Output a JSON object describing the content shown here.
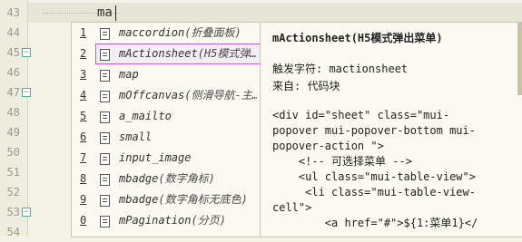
{
  "gutter": {
    "lines": [
      {
        "num": "43",
        "fold": ""
      },
      {
        "num": "44",
        "fold": ""
      },
      {
        "num": "45",
        "fold": "⊟"
      },
      {
        "num": "46",
        "fold": ""
      },
      {
        "num": "47",
        "fold": "⊟"
      },
      {
        "num": "48",
        "fold": ""
      },
      {
        "num": "49",
        "fold": ""
      },
      {
        "num": "50",
        "fold": ""
      },
      {
        "num": "51",
        "fold": ""
      },
      {
        "num": "52",
        "fold": ""
      },
      {
        "num": "53",
        "fold": "⊟"
      },
      {
        "num": "54",
        "fold": ""
      }
    ]
  },
  "editor": {
    "typed_text": "ma"
  },
  "suggestions": [
    {
      "num": "1",
      "label": "maccordion",
      "hint": "(折叠面板)"
    },
    {
      "num": "2",
      "label": "mActionsheet",
      "hint": "(H5模式弹…",
      "selected": true
    },
    {
      "num": "3",
      "label": "map",
      "hint": ""
    },
    {
      "num": "4",
      "label": "mOffcanvas",
      "hint": "(侧滑导航-主…"
    },
    {
      "num": "5",
      "label": "a_mailto",
      "hint": ""
    },
    {
      "num": "6",
      "label": "small",
      "hint": ""
    },
    {
      "num": "7",
      "label": "input_image",
      "hint": ""
    },
    {
      "num": "8",
      "label": "mbadge",
      "hint": "(数字角标)"
    },
    {
      "num": "9",
      "label": "mbadge",
      "hint": "(数字角标无底色)"
    },
    {
      "num": "0",
      "label": "mPagination",
      "hint": "(分页)"
    }
  ],
  "doc": {
    "title": "mActionsheet(H5模式弹出菜单)",
    "trigger": "触发字符: mactionsheet",
    "source": "来自: 代码块",
    "code": "<div id=\"sheet\" class=\"mui-\npopover mui-popover-bottom mui-\npopover-action \">\n    <!-- 可选择菜单 -->\n    <ul class=\"mui-table-view\">\n     <li class=\"mui-table-view-\ncell\">\n        <a href=\"#\">${1:菜单1}</"
  },
  "colors": {
    "background": "#f5f3e8",
    "selection_border": "#c65ad0",
    "fold_icon": "#58a89a"
  }
}
